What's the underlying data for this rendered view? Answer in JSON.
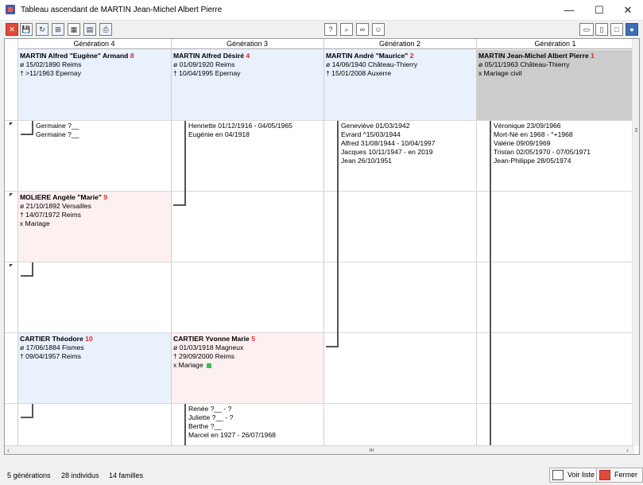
{
  "window": {
    "title": "Tableau ascendant de  MARTIN Jean-Michel Albert Pierre",
    "controls": {
      "minimize": "—",
      "maximize": "☐",
      "close": "✕"
    }
  },
  "toolbar": {
    "left": [
      {
        "name": "close-red-icon",
        "glyph": "✕"
      },
      {
        "name": "save-icon",
        "glyph": "💾"
      },
      {
        "name": "refresh-icon",
        "glyph": "↻"
      },
      {
        "name": "tree-icon",
        "glyph": "⊞"
      },
      {
        "name": "film-icon",
        "glyph": "▦"
      },
      {
        "name": "table-icon",
        "glyph": "▤"
      },
      {
        "name": "print-icon",
        "glyph": "⎙"
      }
    ],
    "middle": [
      {
        "name": "help-icon",
        "glyph": "?"
      },
      {
        "name": "search-icon",
        "glyph": "⌕"
      },
      {
        "name": "binoculars-icon",
        "glyph": "∞"
      },
      {
        "name": "person-icon",
        "glyph": "☺"
      }
    ],
    "right": [
      {
        "name": "layout-wide-icon",
        "glyph": "▭"
      },
      {
        "name": "layout-tall-icon",
        "glyph": "▯"
      },
      {
        "name": "layout-box-icon",
        "glyph": "□"
      },
      {
        "name": "person-blue-icon",
        "glyph": "●"
      }
    ]
  },
  "headers": [
    "Génération 4",
    "Génération 3",
    "Génération 2",
    "Génération 1"
  ],
  "persons": [
    {
      "name": "MARTIN Alfred \"Eugène\" Armand",
      "num": "8",
      "birth": "ø 15/02/1890 Reims",
      "death": "† >11/1963 Epernay",
      "marriage": ""
    },
    {
      "name": "MARTIN Alfred Désiré",
      "num": "4",
      "birth": "ø 01/09/1920 Reims",
      "death": "† 10/04/1995 Epernay",
      "marriage": ""
    },
    {
      "name": "MARTIN André \"Maurice\"",
      "num": "2",
      "birth": "ø 14/06/1940 Château-Thierry",
      "death": "† 15/01/2008 Auxerre",
      "marriage": ""
    },
    {
      "name": "MARTIN Jean-Michel Albert Pierre",
      "num": "1",
      "birth": "ø 05/11/1963 Château-Thierry",
      "death": "x Mariage civil",
      "marriage": ""
    },
    {
      "name": "MOLIERE Angèle \"Marie\"",
      "num": "9",
      "birth": "ø 21/10/1892 Versailles",
      "death": "† 14/07/1972 Reims",
      "marriage": "x Mariage"
    },
    {
      "name": "CARTIER Théodore",
      "num": "10",
      "birth": "ø 17/06/1884 Fismes",
      "death": "† 09/04/1957 Reims",
      "marriage": ""
    },
    {
      "name": "CARTIER Yvonne Marie",
      "num": "5",
      "birth": "ø 01/03/1918 Magneux",
      "death": "† 29/09/2000 Reims",
      "marriage": "x Mariage"
    }
  ],
  "siblings": {
    "gen4a": [
      "Germaine  ?__",
      "Germaine  ?__"
    ],
    "gen3a": [
      "Henriette  01/12/1916 - 04/05/1965",
      "Eugénie  en 04/1918"
    ],
    "gen2a": [
      "Geneviève  01/03/1942",
      "Evrard  ^15/03/1944",
      "Alfred  31/08/1944 - 10/04/1997",
      "Jacques  10/11/1947 - en 2019",
      "Jean  26/10/1951"
    ],
    "gen1a": [
      "Véronique  23/09/1966",
      "Mort-Né  en 1968 - °+1968",
      "Valérie  09/09/1969",
      "Tristan  02/05/1970 - 07/05/1971",
      "Jean-Philippe  28/05/1974"
    ],
    "gen3b": [
      "Renée  ?__ - ?",
      "Juliette  ?__ - ?",
      "Berthe  ?__",
      "Marcel  en 1927 - 26/07/1968"
    ]
  },
  "status": {
    "generations": "5 générations",
    "individus": "28 individus",
    "familles": "14 familles",
    "voir_liste": "Voir liste",
    "fermer": "Fermer"
  },
  "colors": {
    "blue_card": "#e8f1fc",
    "pink_card": "#fdf0f0",
    "gray_card": "#cccccc",
    "number_red": "#e0282a"
  }
}
